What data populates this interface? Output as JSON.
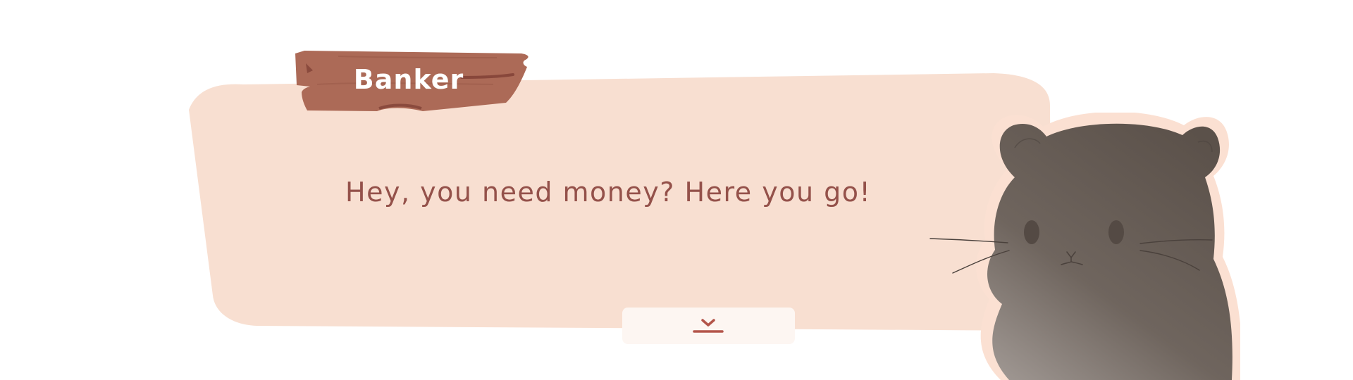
{
  "dialogue": {
    "speaker": "Banker",
    "text": "Hey, you need money? Here you go!"
  },
  "controls": {
    "advance_icon": "chevron-down-bar-icon"
  },
  "character": {
    "icon": "hamster-portrait"
  },
  "colors": {
    "bubble": "#f8dfd1",
    "nameplate": "#ac6a57",
    "nameplate_shadow": "#8a4a3d",
    "text": "#94514a",
    "button_bg": "#fdf6f2",
    "button_icon": "#b3554a",
    "hamster": "#5e5650",
    "hamster_outline": "#fbe0d2"
  }
}
